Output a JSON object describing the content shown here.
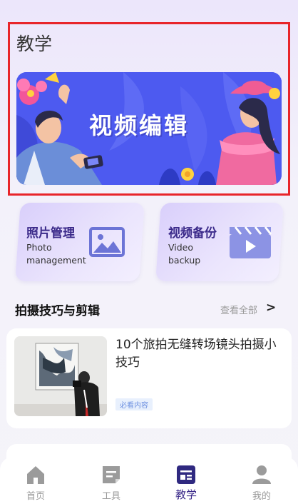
{
  "page": {
    "title": "教学"
  },
  "banner": {
    "title": "视频编辑"
  },
  "cards": [
    {
      "title": "照片管理",
      "subtitle_line1": "Photo",
      "subtitle_line2": "management",
      "icon": "image-icon"
    },
    {
      "title": "视频备份",
      "subtitle_line1": "Video",
      "subtitle_line2": "backup",
      "icon": "video-clapper-icon"
    }
  ],
  "section": {
    "title": "拍摄技巧与剪辑",
    "see_all": "查看全部",
    "arrow": ">"
  },
  "article": {
    "title": "10个旅拍无缝转场镜头拍摄小技巧",
    "tag": "必看内容"
  },
  "tabbar": {
    "items": [
      {
        "label": "首页",
        "icon": "home-icon",
        "active": false
      },
      {
        "label": "工具",
        "icon": "tools-icon",
        "active": false
      },
      {
        "label": "教学",
        "icon": "teach-icon",
        "active": true
      },
      {
        "label": "我的",
        "icon": "profile-icon",
        "active": false
      }
    ]
  },
  "colors": {
    "accent": "#3b2a8a",
    "banner_bg": "#4d5af0",
    "highlight_border": "#e8252a"
  }
}
